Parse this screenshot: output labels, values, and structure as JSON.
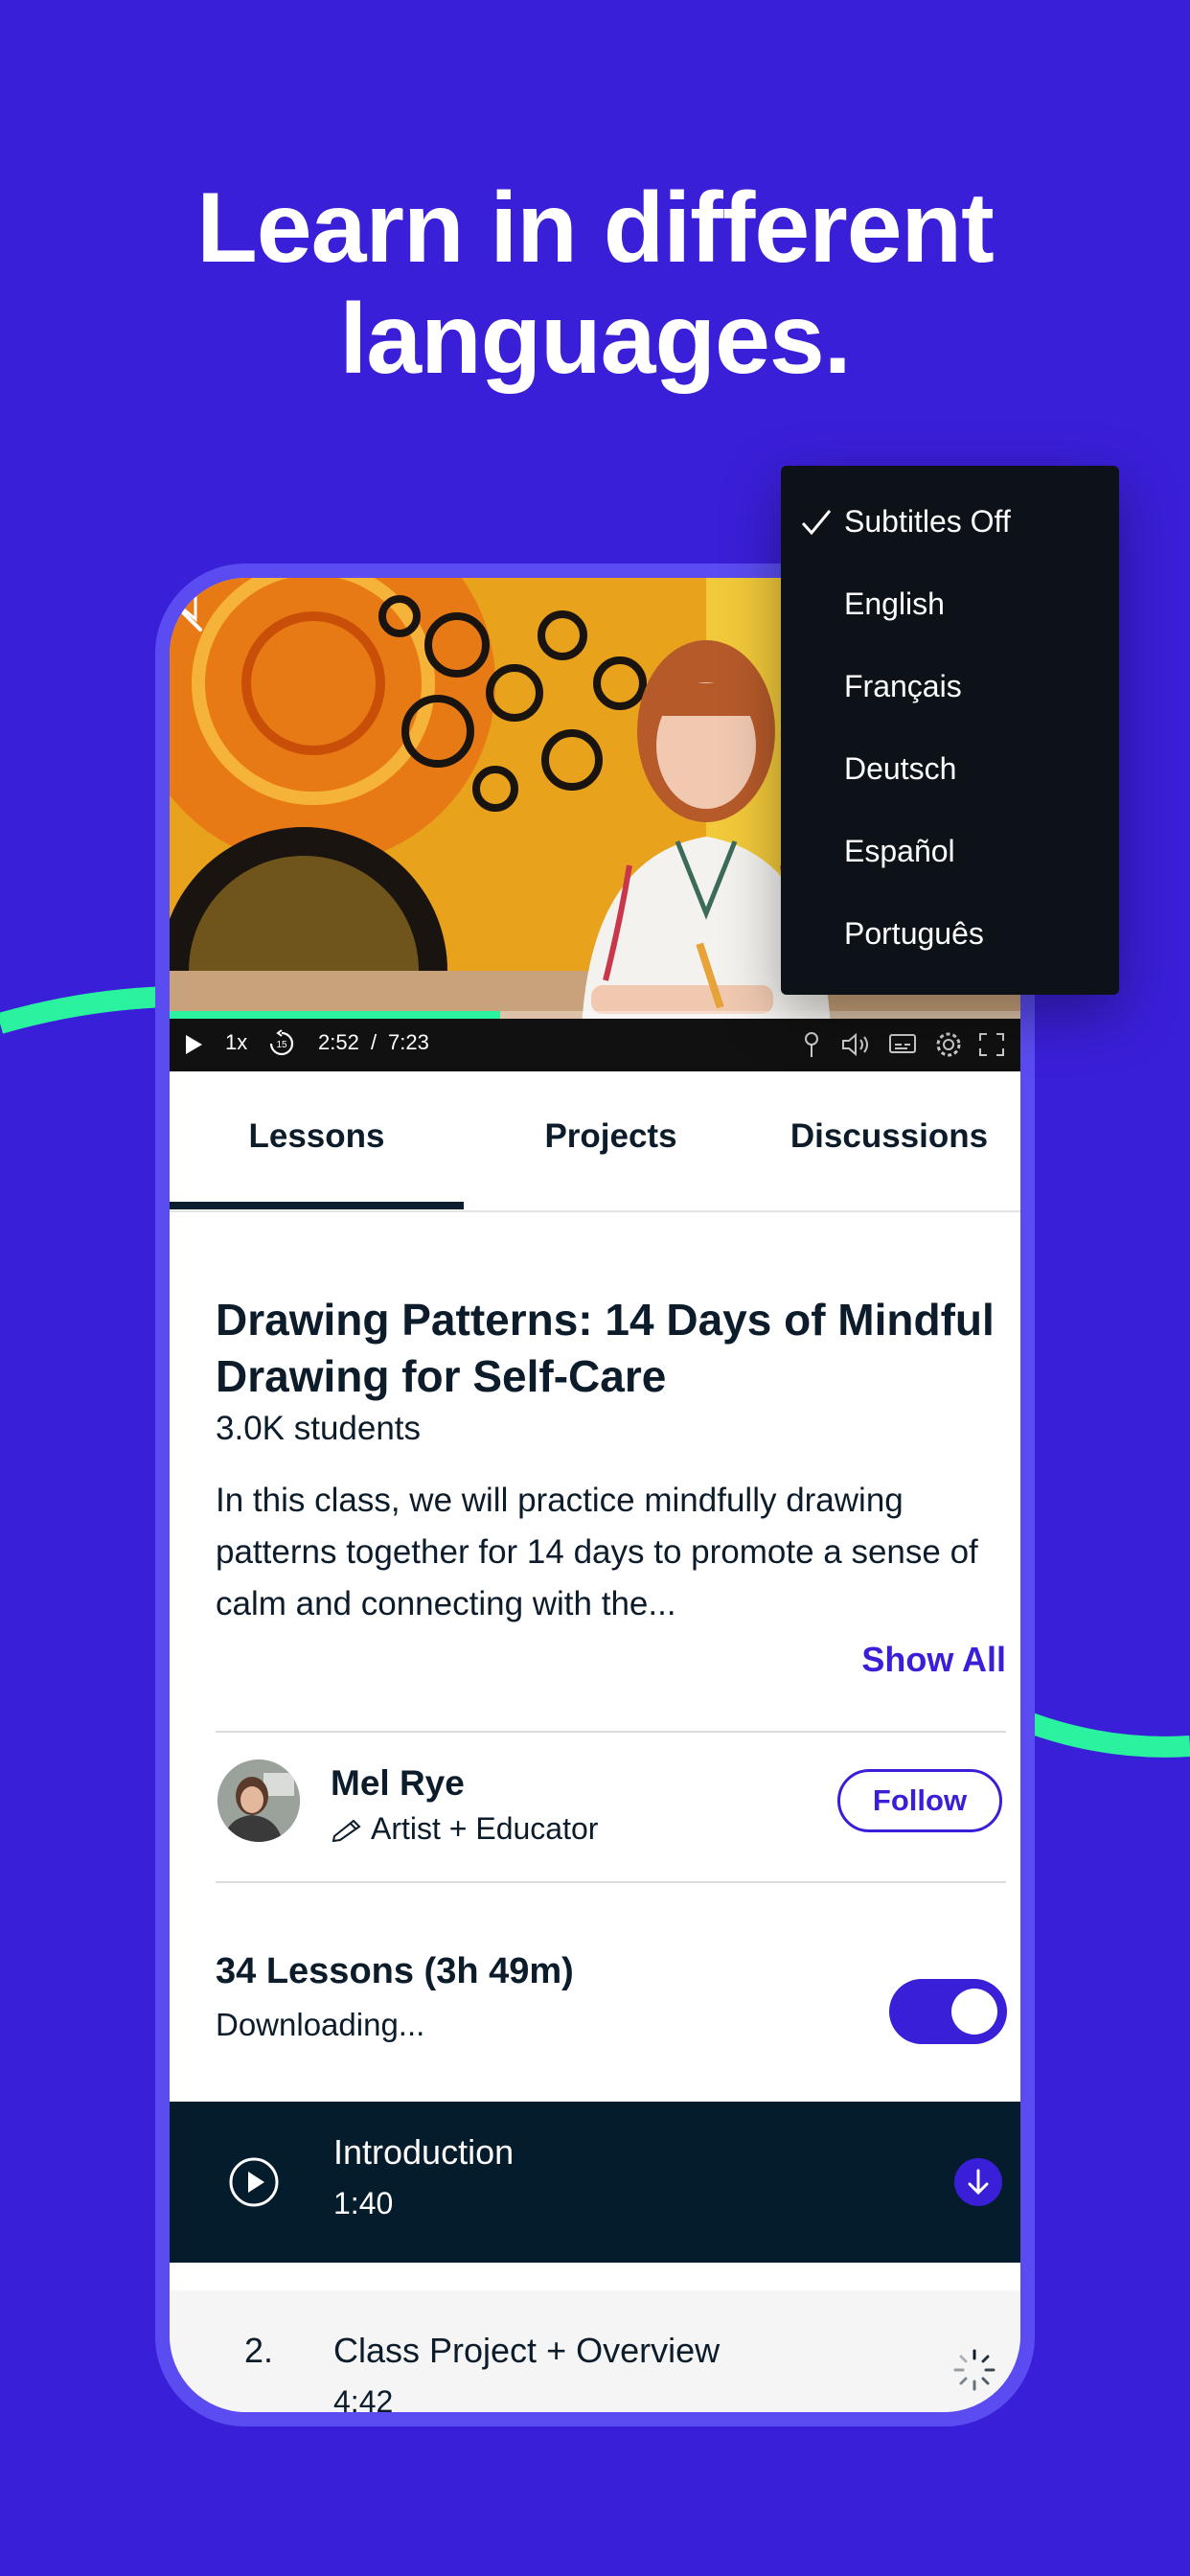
{
  "headline": {
    "line1": "Learn in different",
    "line2": "languages."
  },
  "subtitles_menu": {
    "items": [
      "Subtitles Off",
      "English",
      "Français",
      "Deutsch",
      "Español",
      "Português"
    ],
    "selected": "Subtitles Off"
  },
  "player": {
    "speed": "1x",
    "rewind_label": "15",
    "current_time": "2:52",
    "separator": "/",
    "total_time": "7:23",
    "progress_fraction": 0.389
  },
  "tabs": {
    "items": [
      "Lessons",
      "Projects",
      "Discussions"
    ],
    "active": "Lessons"
  },
  "course": {
    "title": "Drawing Patterns: 14 Days of Mindful Drawing for Self-Care",
    "students": "3.0K students",
    "description": "In this class, we will practice mindfully drawing patterns together for 14 days to promote a sense of calm and connecting with the...",
    "show_all": "Show All"
  },
  "teacher": {
    "name": "Mel Rye",
    "role": "Artist + Educator",
    "follow_label": "Follow"
  },
  "lessons": {
    "summary": "34 Lessons (3h 49m)",
    "status": "Downloading...",
    "download_toggle_on": true,
    "items": [
      {
        "number": "",
        "title": "Introduction",
        "duration": "1:40"
      },
      {
        "number": "2.",
        "title": "Class Project + Overview",
        "duration": "4:42"
      }
    ]
  },
  "colors": {
    "background": "#3a1fd8",
    "accent_green": "#2bf29e",
    "dark_navy": "#051c2c",
    "brand_purple": "#3a1fd8"
  }
}
